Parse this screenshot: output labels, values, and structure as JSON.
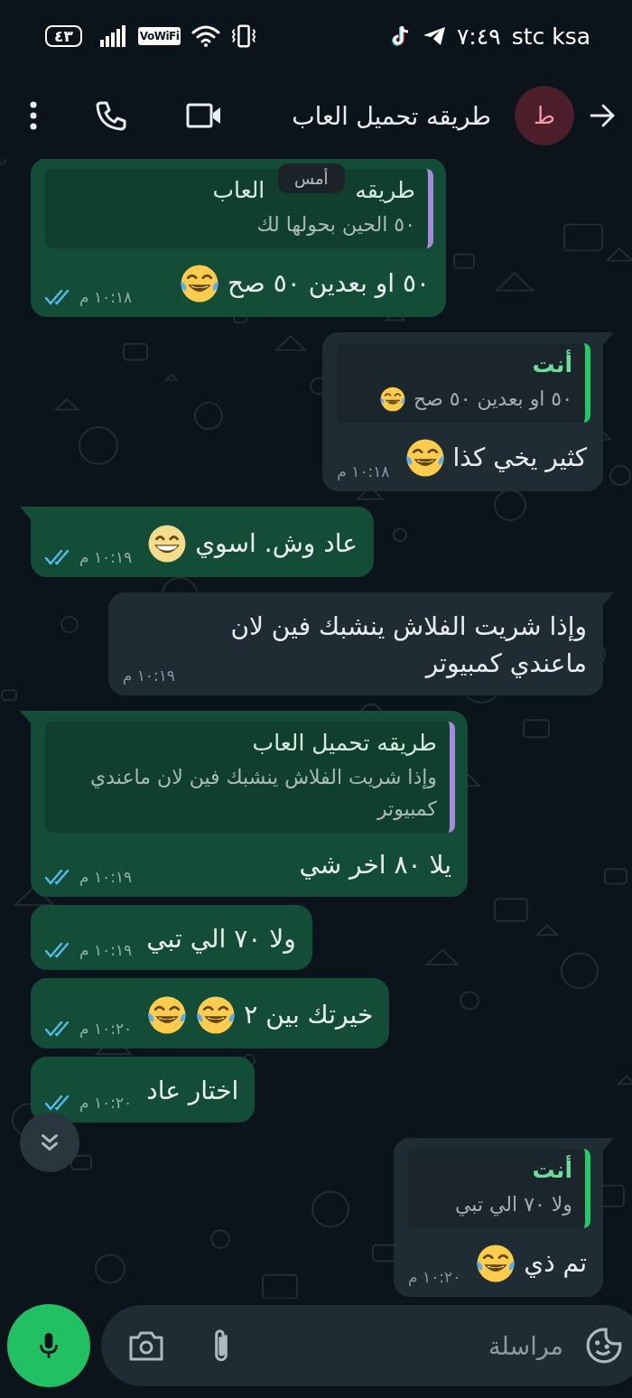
{
  "status_bar": {
    "battery": "٤٣",
    "vowifi_label": "VoWiFi",
    "time": "٧:٤٩",
    "carrier": "stc ksa"
  },
  "header": {
    "avatar_letter": "ط",
    "title": "طريقه تحميل العاب"
  },
  "date_chip": "أمس",
  "messages": [
    {
      "outgoing": true,
      "tail": false,
      "quote": {
        "author_parts": [
          "طريقه",
          "العاب"
        ],
        "text": "٥٠ الحين بحولها لك",
        "color": "#a78bdb"
      },
      "text": "٥٠ او بعدين ٥٠ صح",
      "emojis": [
        {
          "kind": "joy"
        }
      ],
      "time": "١٠:١٨ م",
      "read": true
    },
    {
      "outgoing": false,
      "tail": true,
      "quote": {
        "author": "أنت",
        "text": "٥٠ او بعدين ٥٠ صح",
        "emojis": [
          {
            "kind": "joy"
          }
        ],
        "color": "#25c864"
      },
      "text": "كثير يخي كذا",
      "emojis": [
        {
          "kind": "joy"
        }
      ],
      "time": "١٠:١٨ م"
    },
    {
      "outgoing": true,
      "tail": true,
      "text": "عاد وش. اسوي",
      "emojis": [
        {
          "kind": "grin"
        }
      ],
      "time": "١٠:١٩ م",
      "read": true
    },
    {
      "outgoing": false,
      "tail": true,
      "text": "وإذا شريت الفلاش ينشبك فين لان ماعندي كمبيوتر",
      "time": "١٠:١٩ م"
    },
    {
      "outgoing": true,
      "tail": true,
      "quote": {
        "author": "طريقه تحميل العاب",
        "text": "وإذا شريت الفلاش ينشبك فين لان ماعندي كمبيوتر",
        "color": "#a78bdb"
      },
      "text": "يلا ٨٠ اخر شي",
      "time": "١٠:١٩ م",
      "read": true
    },
    {
      "outgoing": true,
      "tail": false,
      "text": "ولا ٧٠ الي تبي",
      "time": "١٠:١٩ م",
      "read": true
    },
    {
      "outgoing": true,
      "tail": false,
      "text": "خيرتك بين ٢",
      "emojis": [
        {
          "kind": "joy"
        },
        {
          "kind": "joy"
        }
      ],
      "time": "١٠:٢٠ م",
      "read": true
    },
    {
      "outgoing": true,
      "tail": false,
      "text": "اختار عاد",
      "time": "١٠:٢٠ م",
      "read": true
    },
    {
      "outgoing": false,
      "tail": true,
      "quote": {
        "author": "أنت",
        "text": "ولا ٧٠ الي تبي",
        "color": "#25c864"
      },
      "text": "تم ذي",
      "emojis": [
        {
          "kind": "joy"
        }
      ],
      "time": "١٠:٢٠ م"
    }
  ],
  "composer": {
    "placeholder": "مراسلة"
  }
}
